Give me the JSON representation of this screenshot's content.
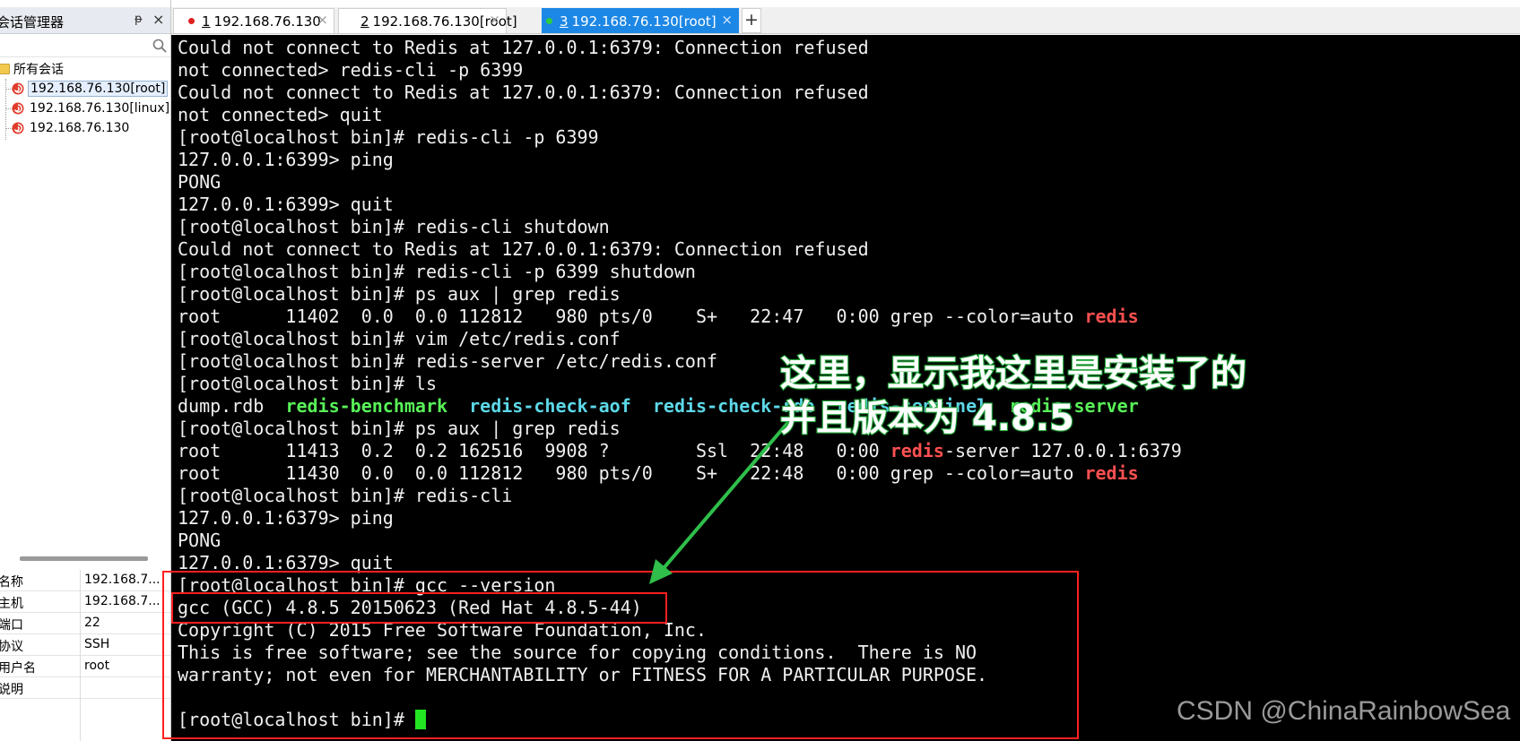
{
  "sidebar": {
    "title": "会话管理器",
    "pin_glyph": "ᵽ",
    "close_glyph": "×",
    "tree_root": "所有会话",
    "sessions": [
      {
        "label": "192.168.76.130[root]"
      },
      {
        "label": "192.168.76.130[linux]"
      },
      {
        "label": "192.168.76.130"
      }
    ],
    "properties": [
      {
        "key": "名称",
        "value": "192.168.7..."
      },
      {
        "key": "主机",
        "value": "192.168.7..."
      },
      {
        "key": "端口",
        "value": "22"
      },
      {
        "key": "协议",
        "value": "SSH"
      },
      {
        "key": "用户名",
        "value": "root"
      },
      {
        "key": "说明",
        "value": ""
      }
    ]
  },
  "tabs": [
    {
      "num": "1",
      "label": "192.168.76.130",
      "dot_color": "#e02020"
    },
    {
      "num": "2",
      "label": "192.168.76.130[root]",
      "dot_color": "#e02020"
    },
    {
      "num": "3",
      "label": "192.168.76.130[root]",
      "dot_color": "#2ecc40"
    }
  ],
  "tab_add": "+",
  "tab_close": "×",
  "terminal": {
    "lines": [
      [
        {
          "t": "Could not connect to Redis at 127.0.0.1:6379: Connection refused"
        }
      ],
      [
        {
          "t": "not connected> redis-cli -p 6399"
        }
      ],
      [
        {
          "t": "Could not connect to Redis at 127.0.0.1:6379: Connection refused"
        }
      ],
      [
        {
          "t": "not connected> quit"
        }
      ],
      [
        {
          "t": "[root@localhost bin]# redis-cli -p 6399"
        }
      ],
      [
        {
          "t": "127.0.0.1:6399> ping"
        }
      ],
      [
        {
          "t": "PONG"
        }
      ],
      [
        {
          "t": "127.0.0.1:6399> quit"
        }
      ],
      [
        {
          "t": "[root@localhost bin]# redis-cli shutdown"
        }
      ],
      [
        {
          "t": "Could not connect to Redis at 127.0.0.1:6379: Connection refused"
        }
      ],
      [
        {
          "t": "[root@localhost bin]# redis-cli -p 6399 shutdown"
        }
      ],
      [
        {
          "t": "[root@localhost bin]# ps aux | grep redis"
        }
      ],
      [
        {
          "t": "root      11402  0.0  0.0 112812   980 pts/0    S+   22:47   0:00 grep --color=auto "
        },
        {
          "t": "redis",
          "c": "red"
        }
      ],
      [
        {
          "t": "[root@localhost bin]# vim /etc/redis.conf"
        }
      ],
      [
        {
          "t": "[root@localhost bin]# redis-server /etc/redis.conf"
        }
      ],
      [
        {
          "t": "[root@localhost bin]# ls"
        }
      ],
      [
        {
          "t": "dump.rdb  "
        },
        {
          "t": "redis-benchmark",
          "c": "green"
        },
        {
          "t": "  "
        },
        {
          "t": "redis-check-aof",
          "c": "cyan"
        },
        {
          "t": "  "
        },
        {
          "t": "redis-check-rdb",
          "c": "cyan"
        },
        {
          "t": "  "
        },
        {
          "t": "redis-sentinel",
          "c": "cyan"
        },
        {
          "t": "  "
        },
        {
          "t": "redis-server",
          "c": "green"
        }
      ],
      [
        {
          "t": "[root@localhost bin]# ps aux | grep redis"
        }
      ],
      [
        {
          "t": "root      11413  0.2  0.2 162516  9908 ?        Ssl  22:48   0:00 "
        },
        {
          "t": "redis",
          "c": "red"
        },
        {
          "t": "-server 127.0.0.1:6379"
        }
      ],
      [
        {
          "t": "root      11430  0.0  0.0 112812   980 pts/0    S+   22:48   0:00 grep --color=auto "
        },
        {
          "t": "redis",
          "c": "red"
        }
      ],
      [
        {
          "t": "[root@localhost bin]# redis-cli"
        }
      ],
      [
        {
          "t": "127.0.0.1:6379> ping"
        }
      ],
      [
        {
          "t": "PONG"
        }
      ],
      [
        {
          "t": "127.0.0.1:6379> quit"
        }
      ],
      [
        {
          "t": "[root@localhost bin]# gcc --version"
        }
      ],
      [
        {
          "t": "gcc (GCC) 4.8.5 20150623 (Red Hat 4.8.5-44)"
        }
      ],
      [
        {
          "t": "Copyright (C) 2015 Free Software Foundation, Inc."
        }
      ],
      [
        {
          "t": "This is free software; see the source for copying conditions.  There is NO"
        }
      ],
      [
        {
          "t": "warranty; not even for MERCHANTABILITY or FITNESS FOR A PARTICULAR PURPOSE."
        }
      ],
      [
        {
          "t": ""
        }
      ],
      [
        {
          "t": "[root@localhost bin]# "
        }
      ]
    ],
    "cursor_color": "#22e522"
  },
  "annotation": {
    "line1": "这里，显示我这里是安装了的",
    "line2": "并且版本为 4.8.5",
    "color": "#2fbf4a",
    "box_color": "#ff2020"
  },
  "watermark": "CSDN @ChinaRainbowSea"
}
